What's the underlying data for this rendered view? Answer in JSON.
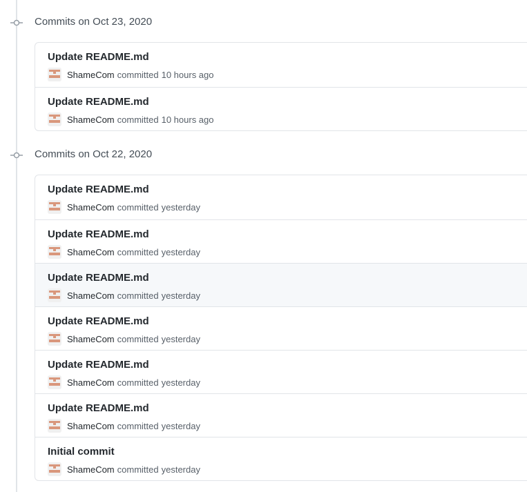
{
  "groups": [
    {
      "title": "Commits on Oct 23, 2020",
      "commits": [
        {
          "message": "Update README.md",
          "author": "ShameCom",
          "verb": "committed",
          "time": "10 hours ago"
        },
        {
          "message": "Update README.md",
          "author": "ShameCom",
          "verb": "committed",
          "time": "10 hours ago"
        }
      ]
    },
    {
      "title": "Commits on Oct 22, 2020",
      "commits": [
        {
          "message": "Update README.md",
          "author": "ShameCom",
          "verb": "committed",
          "time": "yesterday"
        },
        {
          "message": "Update README.md",
          "author": "ShameCom",
          "verb": "committed",
          "time": "yesterday"
        },
        {
          "message": "Update README.md",
          "author": "ShameCom",
          "verb": "committed",
          "time": "yesterday"
        },
        {
          "message": "Update README.md",
          "author": "ShameCom",
          "verb": "committed",
          "time": "yesterday"
        },
        {
          "message": "Update README.md",
          "author": "ShameCom",
          "verb": "committed",
          "time": "yesterday"
        },
        {
          "message": "Update README.md",
          "author": "ShameCom",
          "verb": "committed",
          "time": "yesterday"
        },
        {
          "message": "Initial commit",
          "author": "ShameCom",
          "verb": "committed",
          "time": "yesterday"
        }
      ]
    }
  ],
  "icons": {
    "commit_node": "commit-node-icon",
    "avatar": "avatar-identicon"
  },
  "colors": {
    "timeline": "#e1e4e8",
    "avatar_primary": "#d9977c",
    "avatar_bg": "#f0f0f0",
    "row_highlight": "#f6f8fa"
  }
}
